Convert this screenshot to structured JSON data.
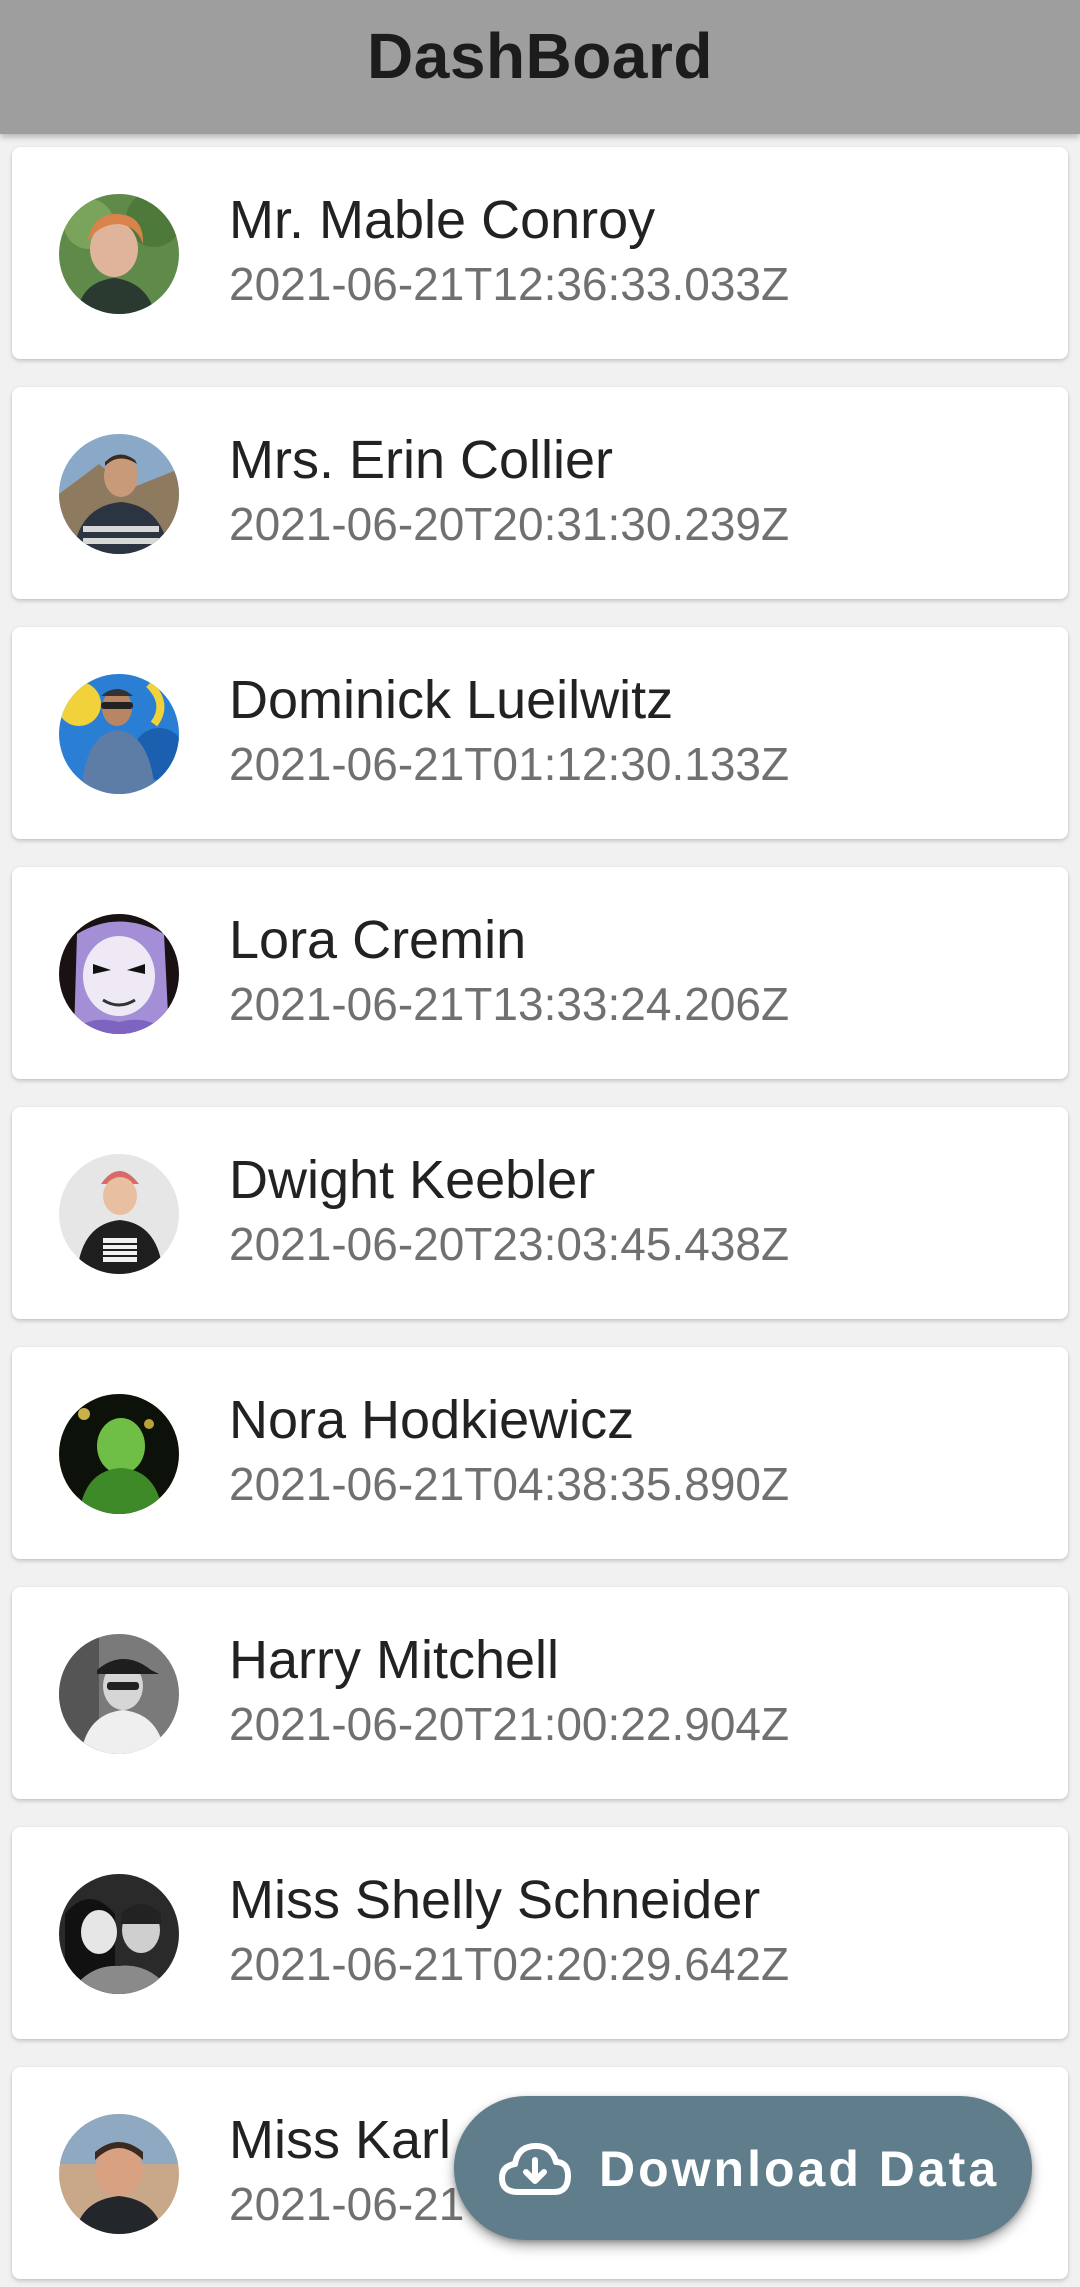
{
  "header": {
    "title": "DashBoard"
  },
  "colors": {
    "header_bg": "#9e9e9e",
    "fab_bg": "#607d8b",
    "name_text": "#222222",
    "time_text": "#707070"
  },
  "users": [
    {
      "name": "Mr. Mable Conroy",
      "timestamp": "2021-06-21T12:36:33.033Z"
    },
    {
      "name": "Mrs. Erin Collier",
      "timestamp": "2021-06-20T20:31:30.239Z"
    },
    {
      "name": "Dominick Lueilwitz",
      "timestamp": "2021-06-21T01:12:30.133Z"
    },
    {
      "name": "Lora Cremin",
      "timestamp": "2021-06-21T13:33:24.206Z"
    },
    {
      "name": "Dwight Keebler",
      "timestamp": "2021-06-20T23:03:45.438Z"
    },
    {
      "name": "Nora Hodkiewicz",
      "timestamp": "2021-06-21T04:38:35.890Z"
    },
    {
      "name": "Harry Mitchell",
      "timestamp": "2021-06-20T21:00:22.904Z"
    },
    {
      "name": "Miss Shelly Schneider",
      "timestamp": "2021-06-21T02:20:29.642Z"
    },
    {
      "name": "Miss Karl",
      "timestamp": "2021-06-21"
    }
  ],
  "fab": {
    "label": "Download Data",
    "icon": "cloud-download-icon"
  }
}
